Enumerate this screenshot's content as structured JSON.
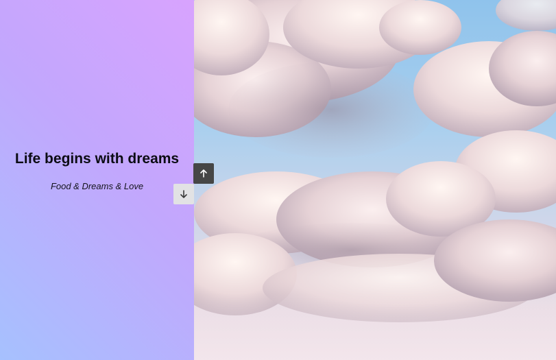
{
  "hero": {
    "title": "Life begins with dreams",
    "subtitle": "Food & Dreams & Love"
  },
  "navigation": {
    "up_icon": "arrow-up-icon",
    "down_icon": "arrow-down-icon"
  },
  "colors": {
    "gradient_start": "#a6c1fe",
    "gradient_end": "#d8a3fe",
    "up_button_bg": "#464646",
    "down_button_bg": "#e2e2e4"
  }
}
